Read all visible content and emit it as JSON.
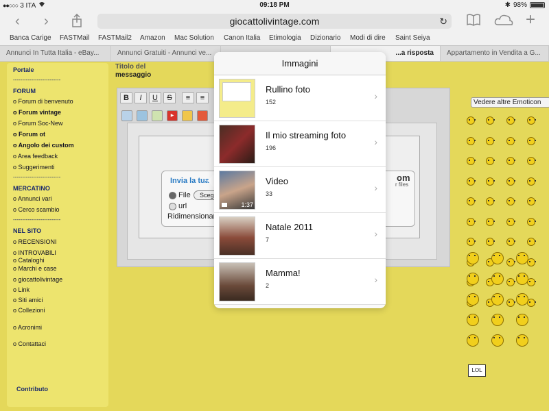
{
  "status_bar": {
    "carrier": "3 ITA",
    "time": "09:18 PM",
    "battery": "98%",
    "battery_level": 0.98
  },
  "toolbar": {
    "back_icon": "chevron-left-icon",
    "forward_icon": "chevron-right-icon",
    "share_icon": "share-icon",
    "url": "giocattolivintage.com",
    "reload_icon": "reload-icon",
    "bookmarks_icon": "book-icon",
    "cloud_icon": "cloud-icon",
    "new_tab_icon": "plus-icon"
  },
  "bookmarks": [
    "Banca Carige",
    "FASTMail",
    "FASTMail2",
    "Amazon",
    "Mac Solution",
    "Canon Italia",
    "Etimologia",
    "Dizionario",
    "Modi di dire",
    "Saint Seiya"
  ],
  "tabs": [
    {
      "label": "Annunci In Tutta Italia - eBay..."
    },
    {
      "label": "Annunci Gratuiti - Annunci ve..."
    },
    {
      "label": ""
    },
    {
      "label": "...a risposta"
    },
    {
      "label": "Appartamento in Vendita a G..."
    }
  ],
  "sidebar": {
    "portale": "Portale",
    "separator": "--------------------------",
    "forum_head": "FORUM",
    "forum_items": [
      "Forum di benvenuto",
      "Forum vintage",
      "Forum Soc-New",
      "Forum ot",
      "Angolo dei custom",
      "Area feedback",
      "Suggerimenti"
    ],
    "mercatino_head": "MERCATINO",
    "mercatino_items": [
      "Annunci vari",
      "Cerco scambio"
    ],
    "nelsito_head": "NEL SITO",
    "nelsito_items": [
      "RECENSIONI",
      "INTROVABILI",
      "Cataloghi",
      "Marchi e case",
      "giocattolivintage",
      "Link",
      "Siti amici",
      "Collezioni",
      "Acronimi",
      "Contattaci"
    ],
    "contributo": "Contributo",
    "bullet": "o"
  },
  "editor": {
    "msg_label_line1": "Titolo del",
    "msg_label_line2": "messaggio",
    "fmt_buttons": [
      "B",
      "I",
      "U",
      "S"
    ],
    "invia_title": "Invia la tua im",
    "file_label": "File",
    "choose_label": "Scegli",
    "url_label": "url",
    "resize_label": "Ridimensionare",
    "logo_text": "om",
    "logo_sub": "r files"
  },
  "emoticons": {
    "more_label": "Vedere altre Emoticon",
    "lol_label": "LOL"
  },
  "popover": {
    "title": "Immagini",
    "albums": [
      {
        "title": "Rullino foto",
        "count": "152"
      },
      {
        "title": "Il mio streaming foto",
        "count": "196"
      },
      {
        "title": "Video",
        "count": "33",
        "duration": "1:37"
      },
      {
        "title": "Natale 2011",
        "count": "7"
      },
      {
        "title": "Mamma!",
        "count": "2"
      }
    ]
  }
}
